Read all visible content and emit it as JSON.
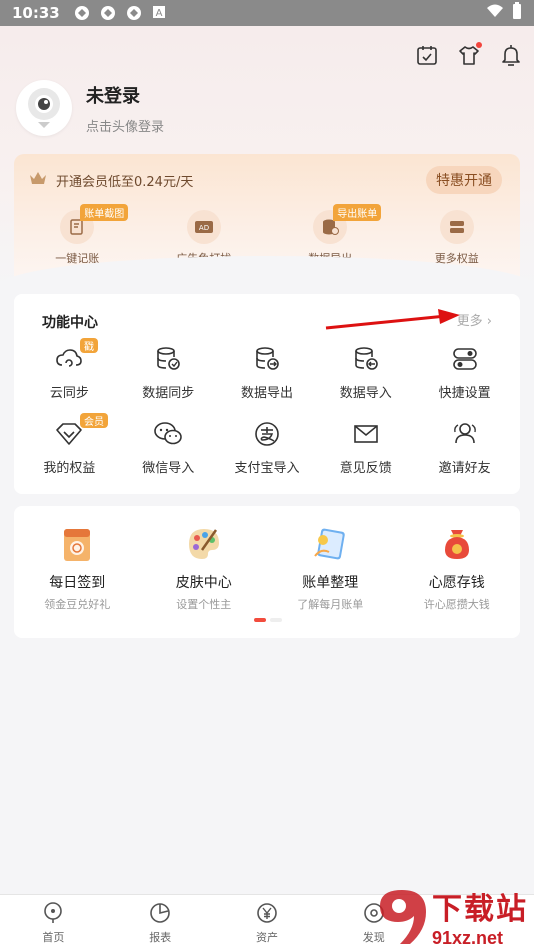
{
  "status_bar": {
    "time": "10:33"
  },
  "profile": {
    "name": "未登录",
    "subtitle": "点击头像登录"
  },
  "vip": {
    "text": "开通会员低至0.24元/天",
    "button": "特惠开通",
    "items": [
      {
        "label": "一键记账",
        "tag": "账单截图",
        "icon": "edit-icon"
      },
      {
        "label": "广告免打扰",
        "tag": "",
        "icon": "ad-icon"
      },
      {
        "label": "数据导出",
        "tag": "导出账单",
        "icon": "database-export-icon"
      },
      {
        "label": "更多权益",
        "tag": "",
        "icon": "more-icon"
      }
    ]
  },
  "feature_center": {
    "title": "功能中心",
    "more": "更多",
    "items": [
      {
        "label": "云同步",
        "tag": "戳",
        "icon": "cloud-sync-icon"
      },
      {
        "label": "数据同步",
        "tag": "",
        "icon": "data-sync-icon"
      },
      {
        "label": "数据导出",
        "tag": "",
        "icon": "data-export-icon"
      },
      {
        "label": "数据导入",
        "tag": "",
        "icon": "data-import-icon"
      },
      {
        "label": "快捷设置",
        "tag": "",
        "icon": "toggle-icon"
      },
      {
        "label": "我的权益",
        "tag": "会员",
        "icon": "diamond-icon"
      },
      {
        "label": "微信导入",
        "tag": "",
        "icon": "wechat-icon"
      },
      {
        "label": "支付宝导入",
        "tag": "",
        "icon": "alipay-icon"
      },
      {
        "label": "意见反馈",
        "tag": "",
        "icon": "mail-icon"
      },
      {
        "label": "邀请好友",
        "tag": "",
        "icon": "friends-icon"
      }
    ]
  },
  "activities": [
    {
      "title": "每日签到",
      "subtitle": "领金豆兑好礼",
      "icon": "calendar-icon"
    },
    {
      "title": "皮肤中心",
      "subtitle": "设置个性主",
      "icon": "palette-icon"
    },
    {
      "title": "账单整理",
      "subtitle": "了解每月账单",
      "icon": "bill-icon"
    },
    {
      "title": "心愿存钱",
      "subtitle": "许心愿攒大钱",
      "icon": "money-bag-icon"
    }
  ],
  "bottom_nav": [
    {
      "label": "首页",
      "icon": "home-icon"
    },
    {
      "label": "报表",
      "icon": "chart-icon"
    },
    {
      "label": "资产",
      "icon": "yen-icon"
    },
    {
      "label": "发现",
      "icon": "discover-icon"
    }
  ],
  "watermark": {
    "brand": "下载站",
    "url": "91xz.net"
  }
}
